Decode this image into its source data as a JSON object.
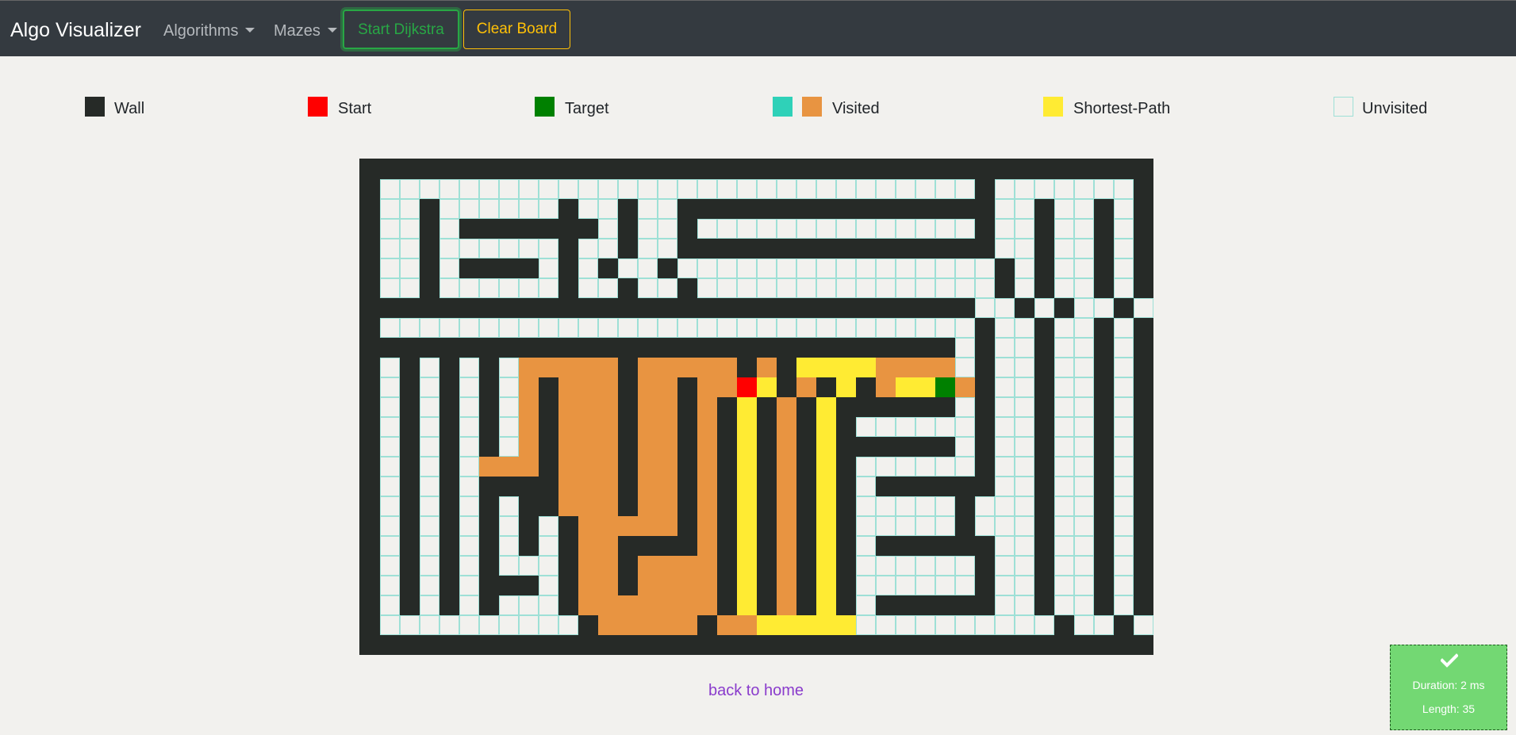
{
  "navbar": {
    "brand": "Algo Visualizer",
    "algorithms_label": "Algorithms",
    "mazes_label": "Mazes",
    "start_label": "Start Dijkstra",
    "clear_label": "Clear Board"
  },
  "legend": [
    {
      "key": "wall",
      "label": "Wall",
      "colors": [
        "#262a27"
      ]
    },
    {
      "key": "start",
      "label": "Start",
      "colors": [
        "#ff0000"
      ]
    },
    {
      "key": "target",
      "label": "Target",
      "colors": [
        "#008000"
      ]
    },
    {
      "key": "visited",
      "label": "Visited",
      "colors": [
        "#2fd1b8",
        "#e89441"
      ]
    },
    {
      "key": "shortest-path",
      "label": "Shortest-Path",
      "colors": [
        "#ffeb33"
      ]
    },
    {
      "key": "unvisited",
      "label": "Unvisited",
      "colors": [
        "#f2f1ee"
      ]
    }
  ],
  "colors": {
    "wall": "#262a27",
    "unvisited": "#f2f1ee",
    "visited": "#e89441",
    "shortest_path": "#ffeb33",
    "start": "#ff0000",
    "target": "#008000",
    "grid_line": "#9ee0d6"
  },
  "maze": {
    "rows": 25,
    "cols": 40,
    "legend_codes": "W=wall, .=unvisited, V=visited, Y=shortest-path, S=start, T=target",
    "cells": [
      "WWWWWWWWWWWWWWWWWWWWWWWWWWWWWWWWWWWWWWWW",
      "W..............................W.......W",
      "W..W......W..W..WWWWWWWWWWWWWWWW..W..W.W",
      "W..W.WWWWWWW.W..W..............W..W..W.W",
      "W..W......W..W..WWWWWWWWWWWWWWWW..W..W.W",
      "W..W.WWWW.W.W..W................W.W..W.W",
      "W..W......W..W..W...............W.W..W.W",
      "WWWWWWWWWWWWWWWWWWWWWWWWWWWWWWW..W.W..W.W",
      "W..............................W..W..W.W",
      "WWWWWWWWWWWWWWWWWWWWWWWWWWWWWW.W..W..W.W",
      "W.W.W.W.VVVVVWVVVVVWVWYYYYVVVV.W..W..W.W",
      "W.W.W.W.VWVVVWVVWVVSYWVWYWVYYTVW..W..W.W",
      "W.W.W.W.VWVVVWVVWVWYWVWYWWWWWW.W..W..W.W",
      "W.W.W.W.VWVVVWVVWVWYWVWYW......W..W..W.W",
      "W.W.W.W.VWVVVWVVWVWYWVWYWWWWWW.W..W..W.W",
      "W.W.W.VVVWVVVWVVWVWYWVWYW......W..W..W.W",
      "W.W.W.WWWWVVVWVVWVWYWVWYW.WWWWWW..W..W.W",
      "W.W.W.W.WWVVVWVVWVWYWVWYW.....W...W..W.W",
      "W.W.W.W.W.WVVVVVWVWYWVWYW.....W...W..W.W",
      "W.W.W.W.W.WVVWWWWVWYWVWYW.WWWWWW..W..W.W",
      "W.W.W.W...WVVWVVVVWYWVWYW......W..W..W.W",
      "W.W.W.WWW.WVVWVVVVWYWVWYW......W..W..W.W",
      "W.W.W.W...WVVVVVVVWYWVWYW.WWWWWW..W..W.W",
      "W..........WVVVVVWVVYYYYY..........W..W.",
      "WWWWWWWWWWWWWWWWWWWWWWWWWWWWWWWWWWWWWWWW"
    ]
  },
  "back_link": "back to home",
  "result": {
    "status": "success",
    "duration": "Duration: 2 ms",
    "length": "Length: 35"
  }
}
